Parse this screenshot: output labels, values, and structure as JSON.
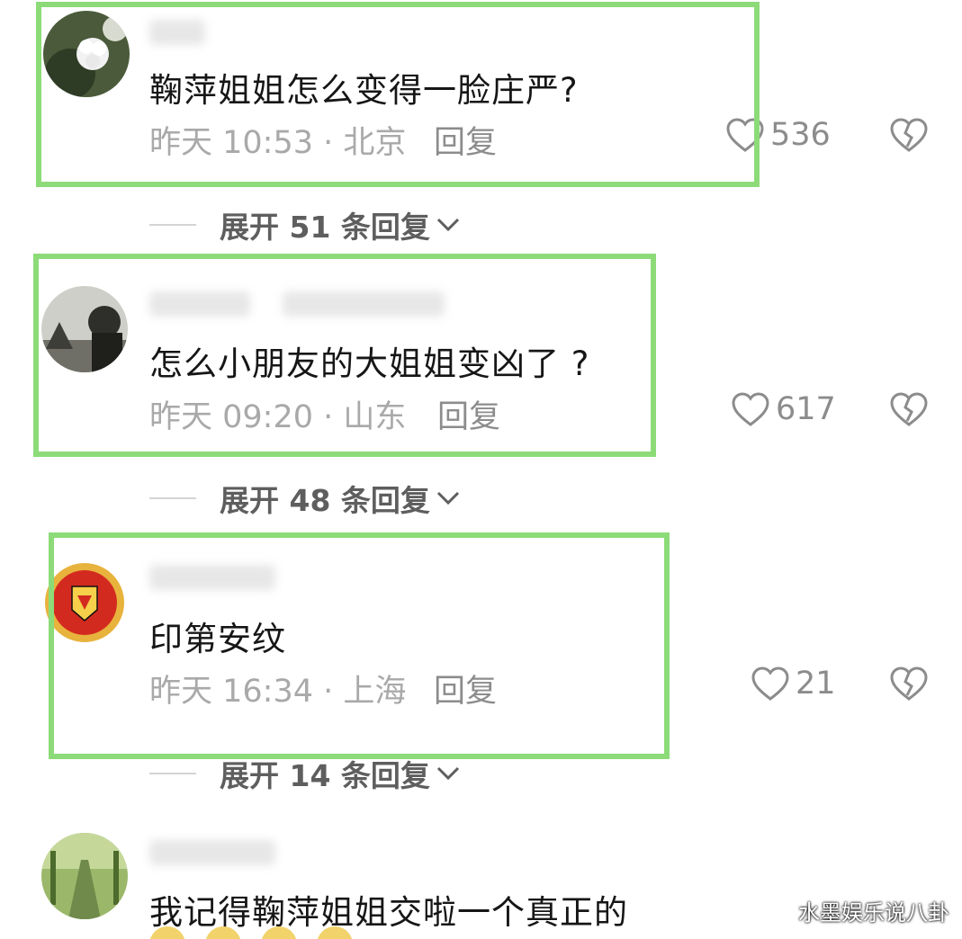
{
  "comments": [
    {
      "content": "鞠萍姐姐怎么变得一脸庄严?",
      "meta": "昨天 10:53 · 北京",
      "reply_label": "回复",
      "likes": "536",
      "expand_label": "展开 51 条回复"
    },
    {
      "content": "怎么小朋友的大姐姐变凶了 ?",
      "meta": "昨天 09:20 · 山东",
      "reply_label": "回复",
      "likes": "617",
      "expand_label": "展开 48 条回复"
    },
    {
      "content": "印第安纹",
      "meta": "昨天 16:34 · 上海",
      "reply_label": "回复",
      "likes": "21",
      "expand_label": "展开 14 条回复"
    },
    {
      "content": "我记得鞠萍姐姐交啦一个真正的"
    }
  ],
  "watermark": "水墨娱乐说八卦",
  "colors": {
    "highlight": "#8cdb78",
    "meta_gray": "#a9a9a9",
    "icon_gray": "#8c8c8c"
  },
  "icons": [
    "heart-outline-icon",
    "broken-heart-icon",
    "chevron-down-icon"
  ]
}
